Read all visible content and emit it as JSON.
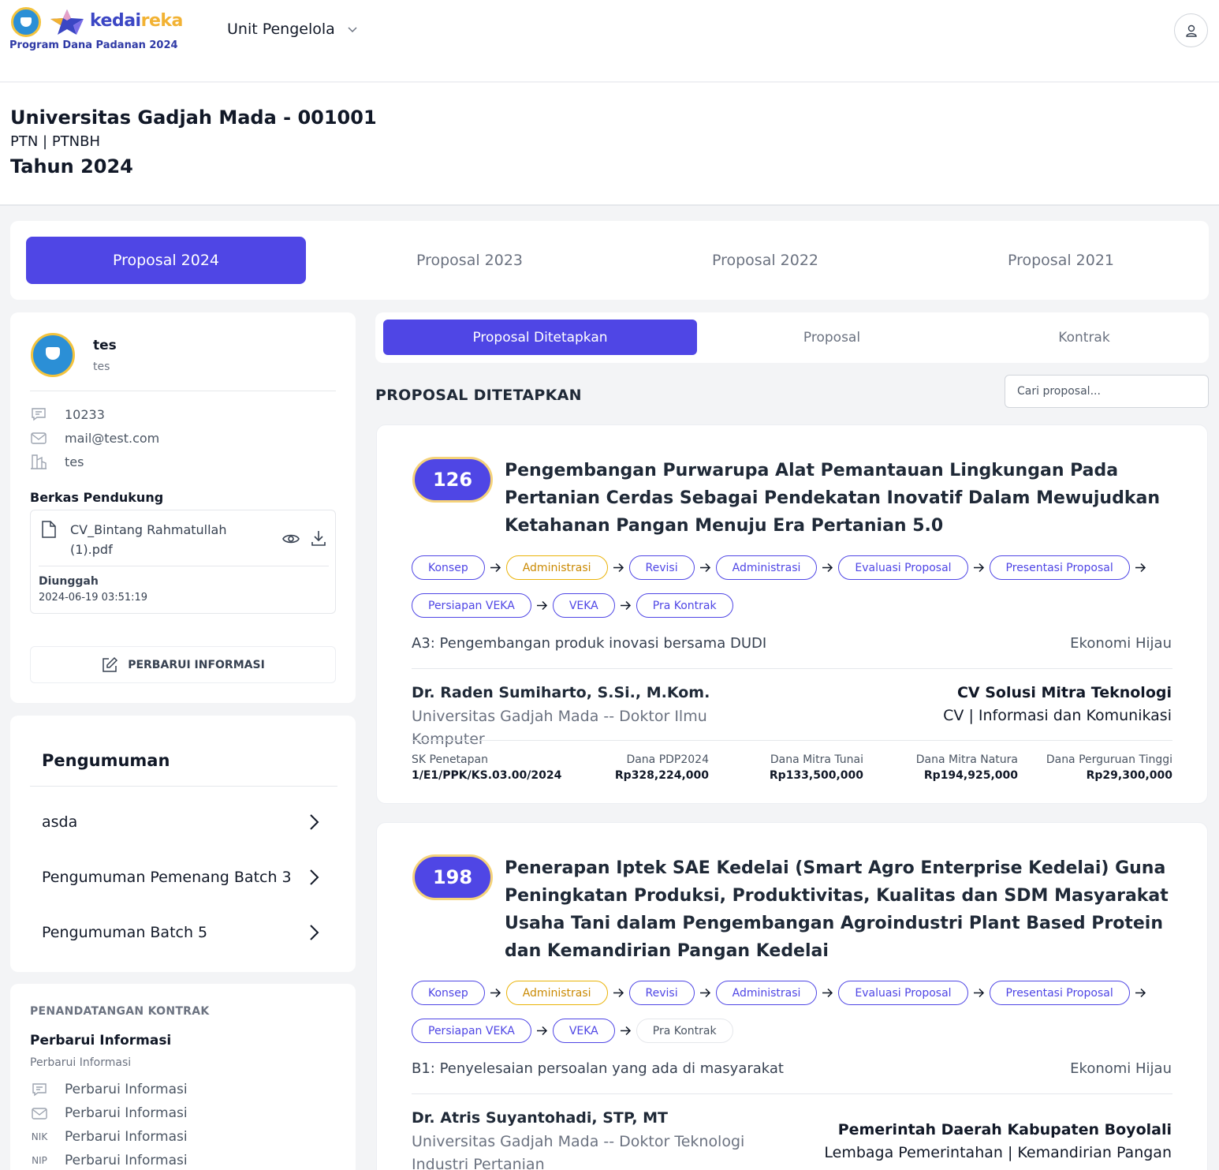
{
  "brand": {
    "name_a": "kedai",
    "name_b": "reka",
    "subtitle": "Program Dana Padanan 2024",
    "primary_color": "#4f46e5",
    "accent_color": "#f2b233"
  },
  "header": {
    "unit_menu": "Unit Pengelola"
  },
  "institution": {
    "name": "Universitas Gadjah Mada - 001001",
    "type": "PTN | PTNBH",
    "year": "Tahun 2024"
  },
  "year_tabs": [
    "Proposal 2024",
    "Proposal 2023",
    "Proposal 2022",
    "Proposal 2021"
  ],
  "profile": {
    "name": "tes",
    "sub": "tes",
    "code": "10233",
    "email": "mail@test.com",
    "building": "tes",
    "berkas_title": "Berkas Pendukung",
    "file_name": "CV_Bintang Rahmatullah (1).pdf",
    "uploaded_label": "Diunggah",
    "uploaded_date": "2024-06-19 03:51:19",
    "update_button": "PERBARUI INFORMASI"
  },
  "announcements": {
    "title": "Pengumuman",
    "items": [
      "asda",
      "Pengumuman Pemenang Batch 3",
      "Pengumuman Batch 5"
    ]
  },
  "contract": {
    "heading": "PENANDATANGAN KONTRAK",
    "title": "Perbarui Informasi",
    "sub": "Perbarui Informasi",
    "rows": [
      {
        "icon": "chat-icon",
        "prefix": "",
        "text": "Perbarui Informasi"
      },
      {
        "icon": "mail-icon",
        "prefix": "",
        "text": "Perbarui Informasi"
      },
      {
        "icon": "",
        "prefix": "NIK",
        "text": "Perbarui Informasi"
      },
      {
        "icon": "",
        "prefix": "NIP",
        "text": "Perbarui Informasi"
      }
    ]
  },
  "subtabs": [
    "Proposal Ditetapkan",
    "Proposal",
    "Kontrak"
  ],
  "section_title": "PROPOSAL DITETAPKAN",
  "search": {
    "placeholder": "Cari proposal..."
  },
  "finance_labels": [
    "SK Penetapan",
    "Dana PDP2024",
    "Dana Mitra Tunai",
    "Dana Mitra Natura",
    "Dana Perguruan Tinggi"
  ],
  "proposals": [
    {
      "number": "126",
      "title": "Pengembangan Purwarupa Alat Pemantauan Lingkungan Pada Pertanian Cerdas Sebagai Pendekatan Inovatif Dalam Mewujudkan Ketahanan Pangan Menuju Era Pertanian 5.0",
      "steps": [
        {
          "label": "Konsep",
          "state": "done"
        },
        {
          "label": "Administrasi",
          "state": "warn"
        },
        {
          "label": "Revisi",
          "state": "done"
        },
        {
          "label": "Administrasi",
          "state": "done"
        },
        {
          "label": "Evaluasi Proposal",
          "state": "done"
        },
        {
          "label": "Presentasi Proposal",
          "state": "done"
        },
        {
          "label": "Persiapan VEKA",
          "state": "done"
        },
        {
          "label": "VEKA",
          "state": "done"
        },
        {
          "label": "Pra Kontrak",
          "state": "done"
        }
      ],
      "category": "A3: Pengembangan produk inovasi bersama DUDI",
      "field": "Ekonomi Hijau",
      "leader": "Dr. Raden Sumiharto, S.Si., M.Kom.",
      "leader_aff": "Universitas Gadjah Mada -- Doktor Ilmu Komputer",
      "partner": "CV Solusi Mitra Teknologi",
      "partner_type": "CV | Informasi dan Komunikasi",
      "sk": "1/E1/PPK/KS.03.00/2024",
      "dana_pdp": "Rp328,224,000",
      "dana_tunai": "Rp133,500,000",
      "dana_natura": "Rp194,925,000",
      "dana_pt": "Rp29,300,000"
    },
    {
      "number": "198",
      "title": "Penerapan Iptek SAE Kedelai (Smart Agro Enterprise Kedelai) Guna Peningkatan Produksi, Produktivitas, Kualitas dan SDM Masyarakat Usaha Tani dalam Pengembangan Agroindustri Plant Based Protein dan Kemandirian Pangan Kedelai",
      "steps": [
        {
          "label": "Konsep",
          "state": "done"
        },
        {
          "label": "Administrasi",
          "state": "warn"
        },
        {
          "label": "Revisi",
          "state": "done"
        },
        {
          "label": "Administrasi",
          "state": "done"
        },
        {
          "label": "Evaluasi Proposal",
          "state": "done"
        },
        {
          "label": "Presentasi Proposal",
          "state": "done"
        },
        {
          "label": "Persiapan VEKA",
          "state": "done"
        },
        {
          "label": "VEKA",
          "state": "done"
        },
        {
          "label": "Pra Kontrak",
          "state": "off"
        }
      ],
      "category": "B1: Penyelesaian persoalan yang ada di masyarakat",
      "field": "Ekonomi Hijau",
      "leader": "Dr. Atris Suyantohadi, STP, MT",
      "leader_aff": "Universitas Gadjah Mada -- Doktor Teknologi Industri Pertanian",
      "partner": "Pemerintah Daerah Kabupaten Boyolali",
      "partner_type": "Lembaga Pemerintahan | Kemandirian Pangan"
    }
  ]
}
